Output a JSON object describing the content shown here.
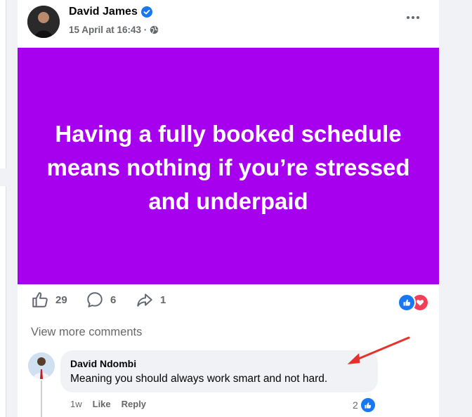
{
  "post": {
    "author": "David James",
    "timestamp": "15 April at 16:43 ·",
    "privacy_icon": "globe-icon",
    "image_text": "Having a fully booked schedule means nothing if you’re stressed and underpaid",
    "image_bg": "#a600ee"
  },
  "stats": {
    "likes": "29",
    "comments": "6",
    "shares": "1"
  },
  "comments": {
    "view_more": "View more comments",
    "items": [
      {
        "author": "David Ndombi",
        "text": "Meaning you should always work smart and not hard.",
        "time": "1w",
        "like_label": "Like",
        "reply_label": "Reply",
        "reaction_count": "2"
      }
    ]
  },
  "colors": {
    "brand_blue": "#1877f2",
    "love_red": "#f33e58",
    "annotation_arrow": "#e5322d"
  }
}
